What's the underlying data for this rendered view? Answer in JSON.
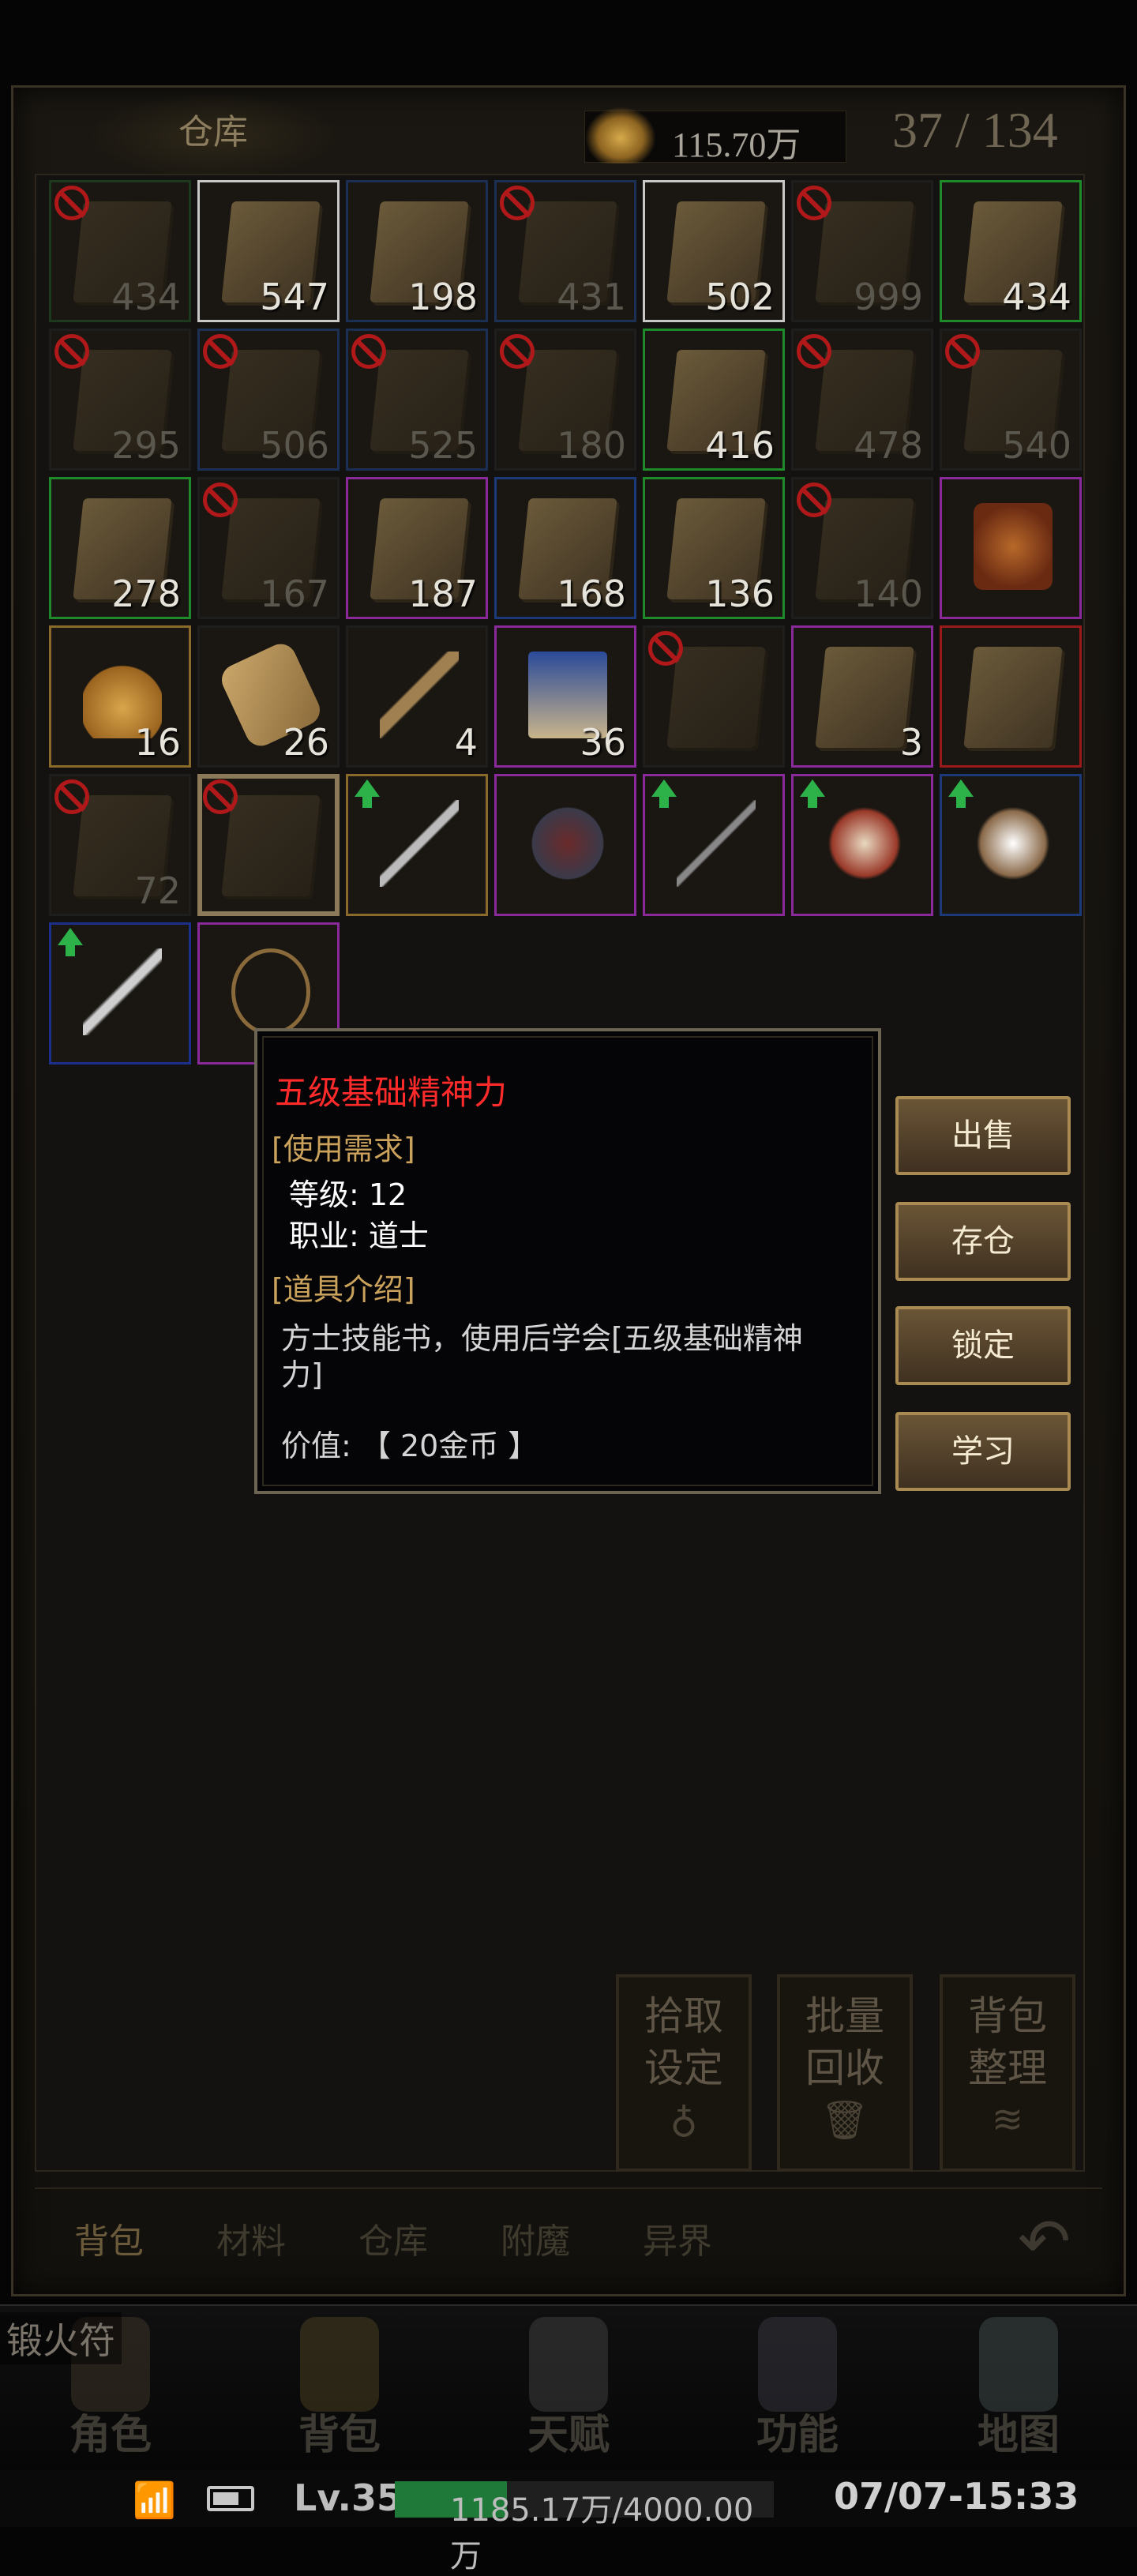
{
  "header": {
    "title": "仓库",
    "gold": "115.70万",
    "capacity": "37 / 134"
  },
  "grid": {
    "rows": [
      [
        {
          "count": "434",
          "banned": true,
          "dim": true,
          "border": "#1e3a1e"
        },
        {
          "count": "547",
          "banned": false,
          "dim": false,
          "border": "#c8c8c8"
        },
        {
          "count": "198",
          "banned": false,
          "dim": false,
          "border": "#1c2f55"
        },
        {
          "count": "431",
          "banned": true,
          "dim": true,
          "border": "#1c2f55"
        },
        {
          "count": "502",
          "banned": false,
          "dim": false,
          "border": "#c8c8c8"
        },
        {
          "count": "999",
          "banned": true,
          "dim": true,
          "border": "#1e1e1e"
        },
        {
          "count": "434",
          "banned": false,
          "dim": false,
          "border": "#1f8a2a"
        }
      ],
      [
        {
          "count": "295",
          "banned": true,
          "dim": true,
          "border": "#1e1e1e"
        },
        {
          "count": "506",
          "banned": true,
          "dim": true,
          "border": "#1c2f55"
        },
        {
          "count": "525",
          "banned": true,
          "dim": true,
          "border": "#1c2f55"
        },
        {
          "count": "180",
          "banned": true,
          "dim": true,
          "border": "#1e1e1e"
        },
        {
          "count": "416",
          "banned": false,
          "dim": false,
          "border": "#1f8a2a"
        },
        {
          "count": "478",
          "banned": true,
          "dim": true,
          "border": "#1e1e1e"
        },
        {
          "count": "540",
          "banned": true,
          "dim": true,
          "border": "#1e1e1e"
        }
      ],
      [
        {
          "count": "278",
          "banned": false,
          "dim": false,
          "border": "#1f8a2a"
        },
        {
          "count": "167",
          "banned": true,
          "dim": true,
          "border": "#1e1e1e"
        },
        {
          "count": "187",
          "banned": false,
          "dim": false,
          "border": "#8a2a9a"
        },
        {
          "count": "168",
          "banned": false,
          "dim": false,
          "border": "#1c3a7a"
        },
        {
          "count": "136",
          "banned": false,
          "dim": false,
          "border": "#1f8a2a"
        },
        {
          "count": "140",
          "banned": true,
          "dim": true,
          "border": "#1e1e1e"
        },
        {
          "count": "",
          "banned": false,
          "dim": false,
          "border": "#8a2a9a",
          "thing": "chest"
        }
      ],
      [
        {
          "count": "16",
          "banned": false,
          "dim": false,
          "border": "#8a6a2a",
          "thing": "gourd"
        },
        {
          "count": "26",
          "banned": false,
          "dim": false,
          "border": "#1e1e1e",
          "thing": "scroll"
        },
        {
          "count": "4",
          "banned": false,
          "dim": false,
          "border": "#1e1e1e",
          "thing": "key"
        },
        {
          "count": "36",
          "banned": false,
          "dim": false,
          "border": "#8a2a9a",
          "thing": "map"
        },
        {
          "count": "",
          "banned": true,
          "dim": true,
          "border": "#1e1e1e"
        },
        {
          "count": "3",
          "banned": false,
          "dim": false,
          "border": "#8a2a9a"
        },
        {
          "count": "",
          "banned": false,
          "dim": false,
          "border": "#9a1a1a"
        }
      ],
      [
        {
          "count": "72",
          "banned": true,
          "dim": true,
          "border": "#1e1e1e"
        },
        {
          "count": "",
          "banned": true,
          "dim": true,
          "border": "#8a7a5a",
          "selected": true
        },
        {
          "count": "",
          "banned": false,
          "dim": false,
          "border": "#8a6a2a",
          "up": true,
          "thing": "axe"
        },
        {
          "count": "",
          "banned": false,
          "dim": false,
          "border": "#8a2a9a",
          "thing": "helm"
        },
        {
          "count": "",
          "banned": false,
          "dim": false,
          "border": "#8a2a9a",
          "up": true,
          "thing": "sword"
        },
        {
          "count": "",
          "banned": false,
          "dim": false,
          "border": "#8a2a9a",
          "up": true,
          "thing": "orb"
        },
        {
          "count": "",
          "banned": false,
          "dim": false,
          "border": "#1c3a7a",
          "up": true,
          "thing": "orb2"
        }
      ],
      [
        {
          "count": "",
          "banned": false,
          "dim": false,
          "border": "#1c2f8a",
          "up": true,
          "thing": "blade"
        },
        {
          "count": "",
          "banned": false,
          "dim": false,
          "border": "#8a2a9a",
          "thing": "necklace"
        }
      ]
    ]
  },
  "tooltip": {
    "item_name": "五级基础精神力",
    "req_header": "[使用需求]",
    "level_req": "等级: 12",
    "class_req": "职业: 道士",
    "desc_header": "[道具介绍]",
    "description": "方士技能书，使用后学会[五级基础精神力]",
    "value": "价值: 【 20金币 】"
  },
  "actions": {
    "sell": "出售",
    "store": "存仓",
    "lock": "锁定",
    "learn": "学习"
  },
  "functions": {
    "pickup": "拾取\n设定",
    "batch": "批量\n回收",
    "sort": "背包\n整理"
  },
  "tabs": [
    "背包",
    "材料",
    "仓库",
    "附魔",
    "异界"
  ],
  "notice": "锻火符",
  "nav": [
    "角色",
    "背包",
    "天赋",
    "功能",
    "地图"
  ],
  "status": {
    "level": "Lv.35",
    "exp": "1185.17万/4000.00万",
    "exp_fraction": 0.296,
    "time": "07/07-15:33"
  },
  "colors": {
    "tooltip_name": "#ff2a2a",
    "section_header": "#caa25b",
    "button_border": "#a88a52"
  }
}
